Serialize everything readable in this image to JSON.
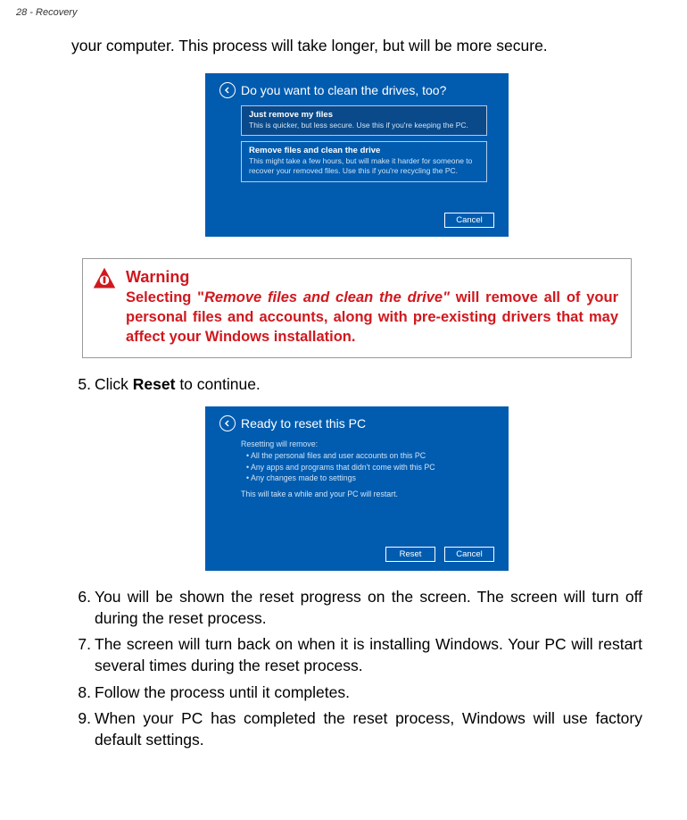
{
  "header": "28 - Recovery",
  "intro": "your computer. This process will take longer, but will be more secure.",
  "screenshot1": {
    "title": "Do you want to clean the drives, too?",
    "opt1_title": "Just remove my files",
    "opt1_desc": "This is quicker, but less secure. Use this if you're keeping the PC.",
    "opt2_title": "Remove files and clean the drive",
    "opt2_desc": "This might take a few hours, but will make it harder for someone to recover your removed files. Use this if you're recycling the PC.",
    "cancel": "Cancel"
  },
  "warning": {
    "title": "Warning",
    "before": "Selecting \"",
    "italic": "Remove files and clean the drive\"",
    "after": " will remove all of your personal files and accounts, along with pre-existing drivers that may affect your Windows installation."
  },
  "step5_num": "5.",
  "step5_a": "Click ",
  "step5_b": "Reset",
  "step5_c": " to continue.",
  "screenshot2": {
    "title": "Ready to reset this PC",
    "l1": "Resetting will remove:",
    "l2": "•  All the personal files and user accounts on this PC",
    "l3": "•  Any apps and programs that didn't come with this PC",
    "l4": "•  Any changes made to settings",
    "note": "This will take a while and your PC will restart.",
    "reset": "Reset",
    "cancel": "Cancel"
  },
  "step6_num": "6.",
  "step6": "You will be shown the reset progress on the screen. The screen will turn off during the reset process.",
  "step7_num": "7.",
  "step7": "The screen will turn back on when it is installing Windows. Your PC will restart several times during the reset process.",
  "step8_num": "8.",
  "step8": "Follow the process until it completes.",
  "step9_num": "9.",
  "step9": "When your PC has completed the reset process, Windows will use factory default settings."
}
